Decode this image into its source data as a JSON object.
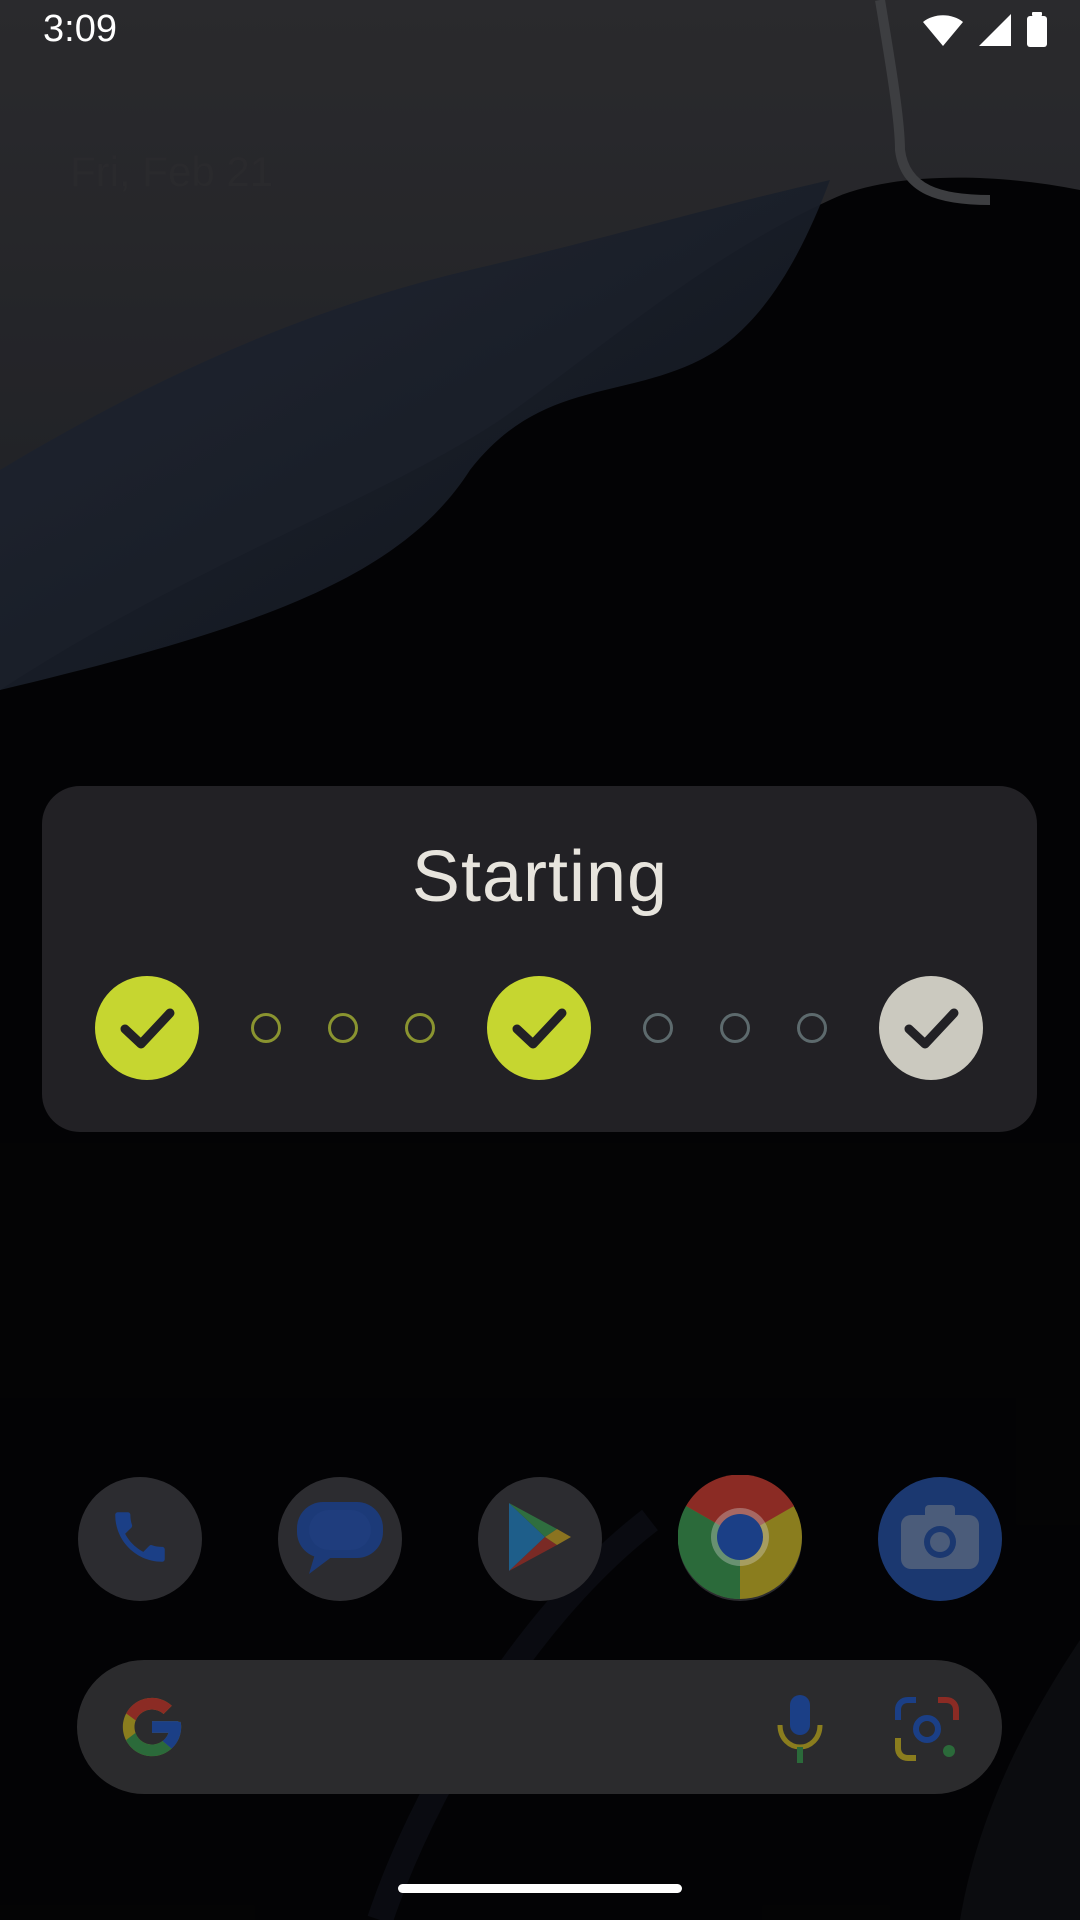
{
  "status_bar": {
    "time": "3:09",
    "icons": [
      "wifi-icon",
      "signal-icon",
      "battery-icon"
    ]
  },
  "home": {
    "date": "Fri, Feb 21"
  },
  "dialog": {
    "title": "Starting",
    "steps": [
      {
        "type": "check",
        "state": "done",
        "color": "#c6d630"
      },
      {
        "type": "dot",
        "state": "done",
        "color": "#8a9430"
      },
      {
        "type": "dot",
        "state": "done",
        "color": "#8a9430"
      },
      {
        "type": "dot",
        "state": "done",
        "color": "#8a9430"
      },
      {
        "type": "check",
        "state": "done",
        "color": "#c6d630"
      },
      {
        "type": "dot",
        "state": "pending",
        "color": "#5d6a6d"
      },
      {
        "type": "dot",
        "state": "pending",
        "color": "#5d6a6d"
      },
      {
        "type": "dot",
        "state": "pending",
        "color": "#5d6a6d"
      },
      {
        "type": "check",
        "state": "pending",
        "color": "#cbc9bf"
      }
    ]
  },
  "dock": {
    "apps": [
      {
        "name": "phone-icon"
      },
      {
        "name": "messages-icon"
      },
      {
        "name": "play-store-icon"
      },
      {
        "name": "chrome-icon"
      },
      {
        "name": "camera-icon"
      }
    ]
  },
  "search": {
    "icons": [
      "google-logo-icon",
      "microphone-icon",
      "google-lens-icon"
    ]
  },
  "colors": {
    "accent_done": "#c6d630",
    "dialog_bg": "#222125",
    "title_text": "#e7e4dd"
  }
}
